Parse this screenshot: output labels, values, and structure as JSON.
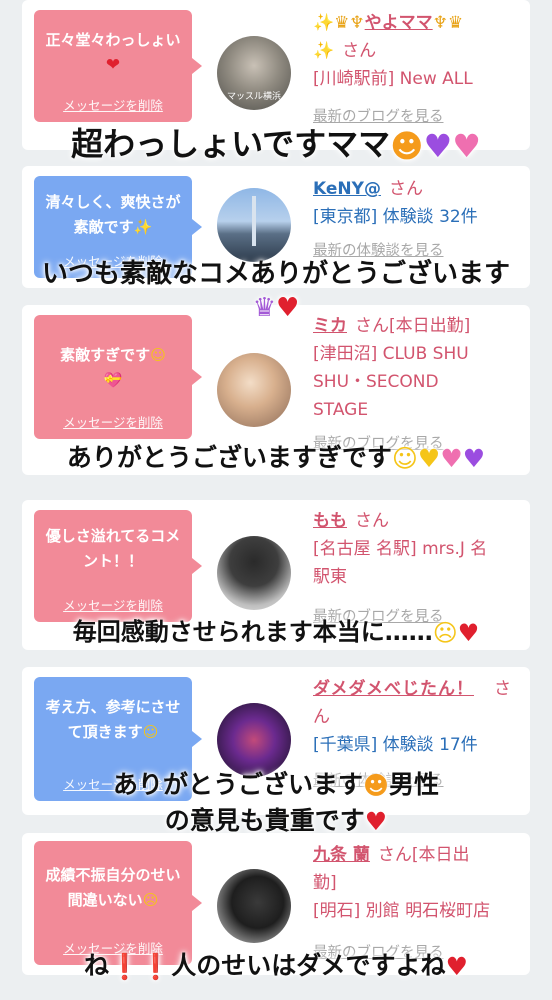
{
  "cards": [
    {
      "bubble_text": "正々堂々わっしょい",
      "delete_label": "メッセージを削除",
      "user_name": "やよママ",
      "san": "さん",
      "lines": [
        "[川崎駅前] New ALL"
      ],
      "more": "最新のブログを見る",
      "avatar_text": "マッスル横浜"
    },
    {
      "bubble_text": "清々しく、爽快さが素敵です",
      "delete_label": "メッセージを削除",
      "user_name": "KeNY@",
      "san": "さん",
      "lines": [
        "[東京都] 体験談 32件"
      ],
      "more": "最新の体験談を見る"
    },
    {
      "bubble_text": "素敵すぎです",
      "delete_label": "メッセージを削除",
      "user_name": "ミカ",
      "san": "さん[本日出勤]",
      "lines": [
        "[津田沼] CLUB SHU",
        "SHU・SECOND",
        "STAGE"
      ],
      "more": "最新のブログを見る"
    },
    {
      "bubble_text": "優しさ溢れてるコメント！！",
      "delete_label": "メッセージを削除",
      "user_name": "もも",
      "san": "さん",
      "lines": [
        "[名古屋 名駅] mrs.J 名",
        "駅東"
      ],
      "more": "最新のブログを見る"
    },
    {
      "bubble_text": "考え方、参考にさせて頂きます",
      "delete_label": "メッセージを削除",
      "user_name": "ダメダメべじたん！",
      "san": "さ",
      "name_line2": "ん",
      "lines": [
        "[千葉県] 体験談 17件"
      ],
      "more": "最新の体験談を見る"
    },
    {
      "bubble_text": "成績不振自分のせい間違いない",
      "delete_label": "メッセージを削除",
      "user_name": "九条 蘭",
      "san": "さん[本日出",
      "name_line2": "勤]",
      "lines": [
        "[明石] 別館 明石桜町店"
      ],
      "more": "最新のブログを見る"
    }
  ],
  "overlays": [
    "超わっしょいですママ",
    "いつも素敵なコメありがとうございます",
    "ありがとうございますぎです",
    "毎回感動させられます本当に……",
    "ありがとうございます",
    "男性",
    "の意見も貴重です",
    "ね",
    "人のせいはダメですよね"
  ],
  "colors": {
    "pink_bubble": "#f28a98",
    "blue_bubble": "#7aa8f2",
    "name_pink": "#d2546e",
    "name_blue": "#2b6fb8"
  }
}
